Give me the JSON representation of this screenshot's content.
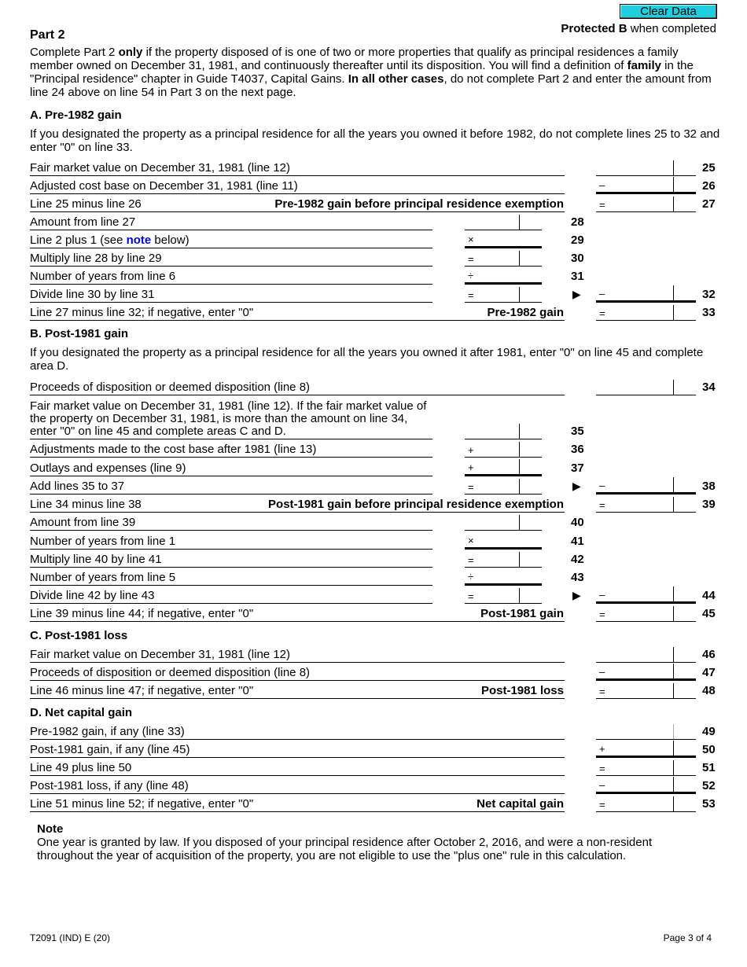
{
  "header": {
    "clear_button": "Clear Data",
    "protected_bold": "Protected B",
    "protected_rest": " when completed",
    "part_title": "Part 2"
  },
  "intro": {
    "t1": "Complete Part 2 ",
    "b1": "only",
    "t2": " if the property disposed of is one of two or more properties that qualify as principal residences a family member owned on December 31, 1981, and continuously thereafter until its disposition. You will find a definition of ",
    "b2": "family",
    "t3": " in the \"Principal residence\" chapter in Guide T4037, Capital Gains. ",
    "b3": "In all other cases",
    "t4": ", do not complete Part 2 and enter the amount from line 24 above on line 54 in Part 3 on the next page."
  },
  "section_a": {
    "title": "A. Pre-1982 gain",
    "desc": "If you designated the property as a principal residence for all the years you owned it before 1982, do not complete lines 25 to 32 and enter \"0\" on line 33.",
    "lines": {
      "l25": {
        "label": "Fair market value on December 31, 1981 (line 12)",
        "num": "25",
        "op": ""
      },
      "l26": {
        "label": "Adjusted cost base on December 31, 1981 (line 11)",
        "num": "26",
        "op": "–"
      },
      "l27": {
        "label": "Line 25 minus line 26",
        "bold": "Pre-1982 gain before principal residence exemption",
        "num": "27",
        "op": "="
      },
      "l28": {
        "label": "Amount from line 27",
        "num": "28",
        "op": ""
      },
      "l29": {
        "label_pre": "Line 2 plus 1 (see ",
        "link": "note",
        "label_post": " below)",
        "num": "29",
        "op": "×"
      },
      "l30": {
        "label": "Multiply line 28 by line 29",
        "num": "30",
        "op": "="
      },
      "l31": {
        "label": "Number of years from line 6",
        "num": "31",
        "op": "÷"
      },
      "l32": {
        "label": "Divide line 30 by line 31",
        "num": "32",
        "op_mid": "=",
        "op": "–",
        "arrow": "▶"
      },
      "l33": {
        "label": "Line 27 minus line 32; if negative, enter \"0\"",
        "bold": "Pre-1982 gain",
        "num": "33",
        "op": "="
      }
    }
  },
  "section_b": {
    "title": "B. Post-1981 gain",
    "desc": "If you designated the property as a principal residence for all the years you owned it after 1981, enter \"0\" on line 45 and complete area D.",
    "lines": {
      "l34": {
        "label": "Proceeds of disposition or deemed disposition (line 8)",
        "num": "34",
        "op": ""
      },
      "l35": {
        "label": "Fair market value on December 31, 1981 (line 12). If the fair market value of the property on December 31, 1981, is more than the amount on line 34, enter \"0\" on line 45 and complete areas C and D.",
        "num": "35",
        "op": ""
      },
      "l36": {
        "label": "Adjustments made to the cost base after 1981 (line 13)",
        "num": "36",
        "op": "+"
      },
      "l37": {
        "label": "Outlays and expenses (line 9)",
        "num": "37",
        "op": "+"
      },
      "l38": {
        "label": "Add lines 35 to 37",
        "num": "38",
        "op_mid": "=",
        "op": "–",
        "arrow": "▶"
      },
      "l39": {
        "label": "Line 34 minus line 38",
        "bold": "Post-1981 gain before principal residence exemption",
        "num": "39",
        "op": "="
      },
      "l40": {
        "label": "Amount from line 39",
        "num": "40",
        "op": ""
      },
      "l41": {
        "label": "Number of years from line 1",
        "num": "41",
        "op": "×"
      },
      "l42": {
        "label": "Multiply line 40 by line 41",
        "num": "42",
        "op": "="
      },
      "l43": {
        "label": "Number of years from line 5",
        "num": "43",
        "op": "÷"
      },
      "l44": {
        "label": "Divide line 42 by line 43",
        "num": "44",
        "op_mid": "=",
        "op": "–",
        "arrow": "▶"
      },
      "l45": {
        "label": "Line 39 minus line 44; if negative, enter \"0\"",
        "bold": "Post-1981 gain",
        "num": "45",
        "op": "="
      }
    }
  },
  "section_c": {
    "title": "C. Post-1981 loss",
    "lines": {
      "l46": {
        "label": "Fair market value on December 31, 1981 (line 12)",
        "num": "46",
        "op": ""
      },
      "l47": {
        "label": "Proceeds of disposition or deemed disposition (line 8)",
        "num": "47",
        "op": "–"
      },
      "l48": {
        "label": "Line 46 minus line 47; if negative, enter \"0\"",
        "bold": "Post-1981 loss",
        "num": "48",
        "op": "="
      }
    }
  },
  "section_d": {
    "title": "D. Net capital gain",
    "lines": {
      "l49": {
        "label": "Pre-1982 gain, if any (line 33)",
        "num": "49",
        "op": ""
      },
      "l50": {
        "label": "Post-1981 gain, if any (line 45)",
        "num": "50",
        "op": "+"
      },
      "l51": {
        "label": "Line 49 plus line 50",
        "num": "51",
        "op": "="
      },
      "l52": {
        "label": "Post-1981 loss, if any (line 48)",
        "num": "52",
        "op": "–"
      },
      "l53": {
        "label": "Line 51 minus line 52; if negative, enter \"0\"",
        "bold": "Net capital gain",
        "num": "53",
        "op": "="
      }
    }
  },
  "note": {
    "title": "Note",
    "text": "One year is granted by law. If you disposed of your principal residence after October 2, 2016, and were a non-resident throughout the year of acquisition of the property, you are not eligible to use the \"plus one\" rule in this calculation."
  },
  "footer": {
    "form_id": "T2091 (IND) E (20)",
    "page": "Page 3 of 4"
  }
}
